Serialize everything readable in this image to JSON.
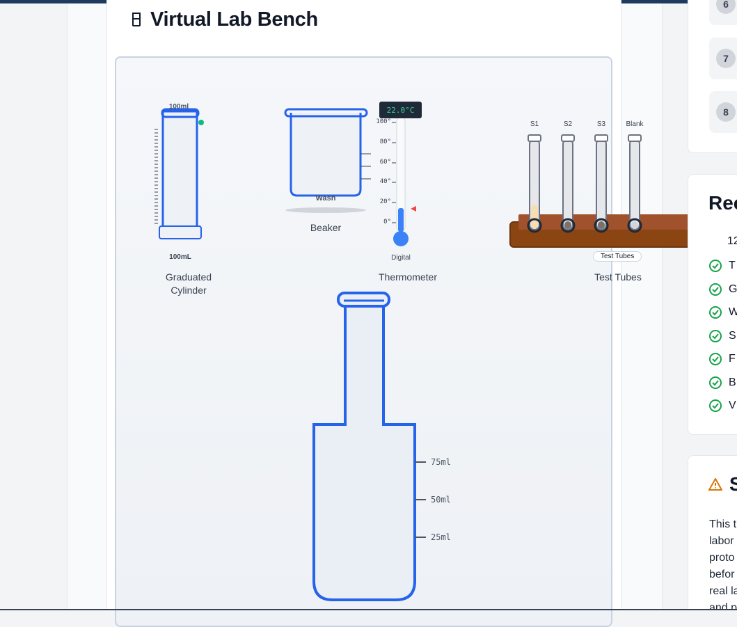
{
  "page": {
    "title": "Virtual Lab Bench",
    "title_icon": "beaker-icon"
  },
  "instruments": {
    "graduated_cylinder": {
      "label": "Graduated\nCylinder",
      "top_mark": "100ml",
      "capacity": "100mL"
    },
    "beaker": {
      "label": "Beaker",
      "inner_text": "Wash"
    },
    "thermometer": {
      "label": "Thermometer",
      "readout": "22.0°C",
      "sublabel": "Digital",
      "scale": [
        "100°",
        "80°",
        "60°",
        "40°",
        "20°",
        "0°"
      ]
    },
    "test_tubes": {
      "label": "Test Tubes",
      "tag": "Test Tubes",
      "tubes": [
        "S1",
        "S2",
        "S3",
        "Blank"
      ]
    },
    "flask": {
      "marks": [
        "75ml",
        "50ml",
        "25ml"
      ]
    }
  },
  "steps": [
    "6",
    "7",
    "8"
  ],
  "requirements": {
    "title": "Rec",
    "first_item": "12",
    "items": [
      "T",
      "G",
      "W",
      "S",
      "F",
      "B",
      "V"
    ]
  },
  "safety": {
    "title": "S",
    "text": [
      "This t",
      "labor",
      "proto",
      "befor",
      "real la",
      "and p"
    ]
  },
  "colors": {
    "instrument_blue": "#2563eb",
    "check_green": "#16a34a",
    "warning_orange": "#d97706",
    "rack_brown": "#8b4513"
  }
}
